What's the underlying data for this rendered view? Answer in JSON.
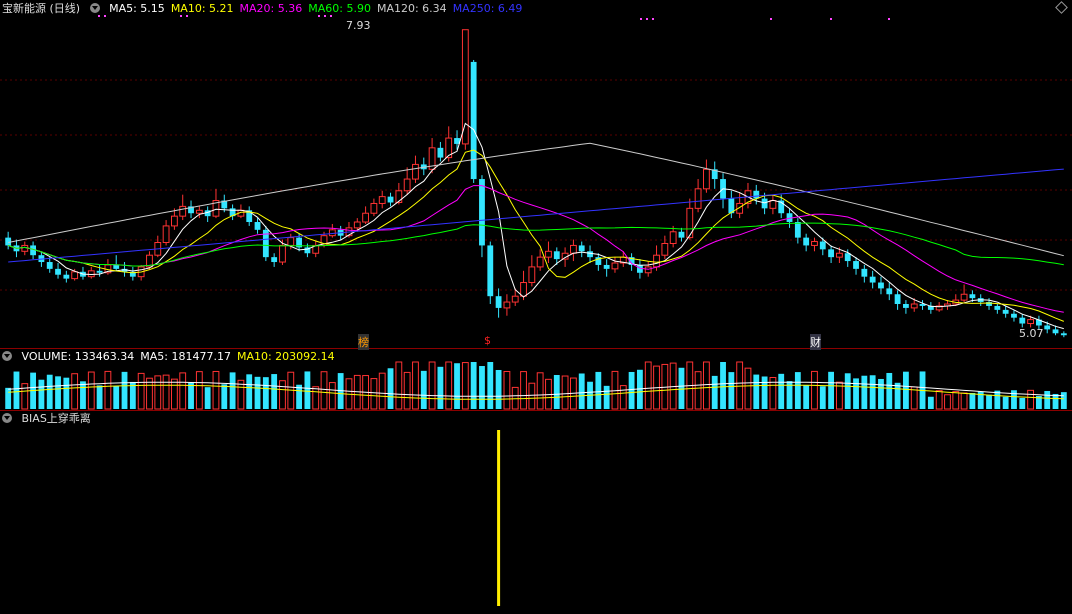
{
  "header": {
    "stock_name": "宝新能源 (日线)",
    "ma_labels": [
      {
        "text": "MA5: 5.15",
        "color": "#ffffff"
      },
      {
        "text": "MA10: 5.21",
        "color": "#ffff00"
      },
      {
        "text": "MA20: 5.36",
        "color": "#ff00ff"
      },
      {
        "text": "MA60: 5.90",
        "color": "#00ff00"
      },
      {
        "text": "MA120: 6.34",
        "color": "#cccccc"
      },
      {
        "text": "MA250: 6.49",
        "color": "#3333ff"
      }
    ]
  },
  "volume_header": {
    "labels": [
      {
        "text": "VOLUME: 133463.34",
        "color": "#ffffff"
      },
      {
        "text": "MA5: 181477.17",
        "color": "#ffffff"
      },
      {
        "text": "MA10: 203092.14",
        "color": "#ffff00"
      }
    ]
  },
  "indicator_header": {
    "label": "BIAS上穿乖离"
  },
  "markers": {
    "high_label": "7.93",
    "low_label": "5.07",
    "event_1": "榜",
    "event_2": "$",
    "event_3": "财"
  },
  "chart_data": {
    "type": "candlestick",
    "price_range": [
      5.0,
      8.0
    ],
    "candles": [
      [
        5.8,
        5.72,
        5.86,
        5.68
      ],
      [
        5.72,
        5.66,
        5.78,
        5.6
      ],
      [
        5.66,
        5.72,
        5.76,
        5.62
      ],
      [
        5.72,
        5.62,
        5.76,
        5.58
      ],
      [
        5.62,
        5.55,
        5.66,
        5.5
      ],
      [
        5.55,
        5.48,
        5.6,
        5.44
      ],
      [
        5.48,
        5.42,
        5.54,
        5.38
      ],
      [
        5.42,
        5.38,
        5.46,
        5.34
      ],
      [
        5.38,
        5.45,
        5.48,
        5.36
      ],
      [
        5.45,
        5.4,
        5.5,
        5.37
      ],
      [
        5.4,
        5.46,
        5.5,
        5.38
      ],
      [
        5.46,
        5.44,
        5.52,
        5.4
      ],
      [
        5.44,
        5.52,
        5.58,
        5.42
      ],
      [
        5.52,
        5.48,
        5.62,
        5.46
      ],
      [
        5.48,
        5.45,
        5.55,
        5.4
      ],
      [
        5.45,
        5.4,
        5.5,
        5.36
      ],
      [
        5.4,
        5.5,
        5.52,
        5.36
      ],
      [
        5.5,
        5.62,
        5.66,
        5.48
      ],
      [
        5.62,
        5.75,
        5.82,
        5.6
      ],
      [
        5.75,
        5.92,
        5.98,
        5.72
      ],
      [
        5.92,
        6.02,
        6.1,
        5.88
      ],
      [
        6.02,
        6.12,
        6.24,
        5.98
      ],
      [
        6.12,
        6.05,
        6.18,
        6.0
      ],
      [
        6.05,
        6.08,
        6.12,
        6.0
      ],
      [
        6.08,
        6.02,
        6.12,
        5.96
      ],
      [
        6.02,
        6.18,
        6.3,
        6.0
      ],
      [
        6.18,
        6.1,
        6.24,
        6.06
      ],
      [
        6.1,
        6.02,
        6.14,
        5.98
      ],
      [
        6.02,
        6.08,
        6.14,
        6.0
      ],
      [
        6.08,
        5.96,
        6.12,
        5.92
      ],
      [
        5.96,
        5.88,
        6.0,
        5.84
      ],
      [
        5.88,
        5.6,
        5.92,
        5.56
      ],
      [
        5.6,
        5.55,
        5.64,
        5.5
      ],
      [
        5.55,
        5.72,
        5.78,
        5.52
      ],
      [
        5.72,
        5.8,
        5.84,
        5.68
      ],
      [
        5.8,
        5.7,
        5.84,
        5.66
      ],
      [
        5.7,
        5.64,
        5.74,
        5.6
      ],
      [
        5.64,
        5.72,
        5.76,
        5.6
      ],
      [
        5.72,
        5.82,
        5.86,
        5.7
      ],
      [
        5.82,
        5.88,
        5.94,
        5.8
      ],
      [
        5.88,
        5.82,
        5.92,
        5.78
      ],
      [
        5.82,
        5.9,
        5.96,
        5.8
      ],
      [
        5.9,
        5.96,
        6.0,
        5.86
      ],
      [
        5.96,
        6.05,
        6.12,
        5.94
      ],
      [
        6.05,
        6.15,
        6.2,
        6.02
      ],
      [
        6.15,
        6.22,
        6.28,
        6.1
      ],
      [
        6.22,
        6.16,
        6.26,
        6.12
      ],
      [
        6.16,
        6.28,
        6.36,
        6.14
      ],
      [
        6.28,
        6.4,
        6.52,
        6.24
      ],
      [
        6.4,
        6.55,
        6.64,
        6.36
      ],
      [
        6.55,
        6.5,
        6.62,
        6.44
      ],
      [
        6.5,
        6.72,
        6.82,
        6.46
      ],
      [
        6.72,
        6.62,
        6.78,
        6.58
      ],
      [
        6.62,
        6.82,
        6.94,
        6.58
      ],
      [
        6.82,
        6.76,
        6.9,
        6.7
      ],
      [
        6.76,
        7.93,
        7.93,
        6.7
      ],
      [
        7.6,
        6.4,
        7.62,
        6.36
      ],
      [
        6.4,
        5.72,
        6.44,
        5.6
      ],
      [
        5.72,
        5.2,
        5.76,
        5.12
      ],
      [
        5.2,
        5.08,
        5.28,
        4.98
      ],
      [
        5.08,
        5.14,
        5.22,
        5.0
      ],
      [
        5.14,
        5.2,
        5.28,
        5.1
      ],
      [
        5.2,
        5.34,
        5.46,
        5.16
      ],
      [
        5.34,
        5.5,
        5.62,
        5.3
      ],
      [
        5.5,
        5.6,
        5.68,
        5.46
      ],
      [
        5.6,
        5.66,
        5.76,
        5.54
      ],
      [
        5.66,
        5.58,
        5.7,
        5.52
      ],
      [
        5.58,
        5.64,
        5.7,
        5.5
      ],
      [
        5.64,
        5.72,
        5.78,
        5.56
      ],
      [
        5.72,
        5.66,
        5.76,
        5.6
      ],
      [
        5.66,
        5.6,
        5.72,
        5.54
      ],
      [
        5.6,
        5.52,
        5.64,
        5.46
      ],
      [
        5.52,
        5.48,
        5.58,
        5.4
      ],
      [
        5.48,
        5.54,
        5.6,
        5.44
      ],
      [
        5.54,
        5.6,
        5.66,
        5.5
      ],
      [
        5.6,
        5.52,
        5.64,
        5.46
      ],
      [
        5.52,
        5.44,
        5.58,
        5.38
      ],
      [
        5.44,
        5.5,
        5.56,
        5.4
      ],
      [
        5.5,
        5.62,
        5.72,
        5.46
      ],
      [
        5.62,
        5.74,
        5.82,
        5.58
      ],
      [
        5.74,
        5.86,
        5.92,
        5.7
      ],
      [
        5.86,
        5.8,
        5.9,
        5.76
      ],
      [
        5.8,
        6.1,
        6.2,
        5.78
      ],
      [
        6.1,
        6.3,
        6.4,
        6.06
      ],
      [
        6.3,
        6.5,
        6.6,
        6.26
      ],
      [
        6.5,
        6.4,
        6.58,
        6.3
      ],
      [
        6.4,
        6.2,
        6.46,
        6.1
      ],
      [
        6.2,
        6.05,
        6.28,
        6.0
      ],
      [
        6.05,
        6.15,
        6.26,
        6.0
      ],
      [
        6.15,
        6.28,
        6.36,
        6.1
      ],
      [
        6.28,
        6.2,
        6.34,
        6.14
      ],
      [
        6.2,
        6.1,
        6.26,
        6.04
      ],
      [
        6.1,
        6.18,
        6.24,
        6.04
      ],
      [
        6.18,
        6.05,
        6.24,
        6.0
      ],
      [
        6.05,
        5.96,
        6.1,
        5.9
      ],
      [
        5.96,
        5.8,
        6.0,
        5.74
      ],
      [
        5.8,
        5.72,
        5.84,
        5.66
      ],
      [
        5.72,
        5.76,
        5.8,
        5.66
      ],
      [
        5.76,
        5.68,
        5.8,
        5.62
      ],
      [
        5.68,
        5.6,
        5.72,
        5.54
      ],
      [
        5.6,
        5.64,
        5.7,
        5.54
      ],
      [
        5.64,
        5.56,
        5.68,
        5.5
      ],
      [
        5.56,
        5.48,
        5.6,
        5.42
      ],
      [
        5.48,
        5.4,
        5.52,
        5.34
      ],
      [
        5.4,
        5.34,
        5.46,
        5.28
      ],
      [
        5.34,
        5.28,
        5.4,
        5.22
      ],
      [
        5.28,
        5.22,
        5.34,
        5.16
      ],
      [
        5.22,
        5.12,
        5.26,
        5.06
      ],
      [
        5.12,
        5.08,
        5.16,
        5.02
      ],
      [
        5.08,
        5.12,
        5.18,
        5.04
      ],
      [
        5.12,
        5.1,
        5.16,
        5.06
      ],
      [
        5.1,
        5.06,
        5.14,
        5.02
      ],
      [
        5.06,
        5.1,
        5.14,
        5.04
      ],
      [
        5.1,
        5.12,
        5.16,
        5.06
      ],
      [
        5.12,
        5.16,
        5.22,
        5.1
      ],
      [
        5.16,
        5.22,
        5.32,
        5.14
      ],
      [
        5.22,
        5.18,
        5.26,
        5.14
      ],
      [
        5.18,
        5.14,
        5.22,
        5.1
      ],
      [
        5.14,
        5.1,
        5.18,
        5.06
      ],
      [
        5.1,
        5.06,
        5.12,
        5.02
      ],
      [
        5.06,
        5.02,
        5.1,
        4.98
      ],
      [
        5.02,
        4.98,
        5.06,
        4.94
      ],
      [
        4.98,
        4.92,
        5.02,
        4.88
      ],
      [
        4.92,
        4.96,
        5.0,
        4.88
      ],
      [
        4.96,
        4.9,
        5.0,
        4.86
      ],
      [
        4.9,
        4.86,
        4.94,
        4.82
      ],
      [
        4.86,
        4.82,
        4.9,
        4.8
      ],
      [
        4.82,
        4.8,
        4.84,
        4.78
      ]
    ],
    "ma_lines": [
      {
        "name": "MA5",
        "color": "#ffffff"
      },
      {
        "name": "MA10",
        "color": "#ffff00"
      },
      {
        "name": "MA20",
        "color": "#ff00ff"
      },
      {
        "name": "MA60",
        "color": "#00ff00"
      },
      {
        "name": "MA120",
        "color": "#cccccc"
      },
      {
        "name": "MA250",
        "color": "#3333ff"
      }
    ],
    "bias_signal_index": 59
  }
}
